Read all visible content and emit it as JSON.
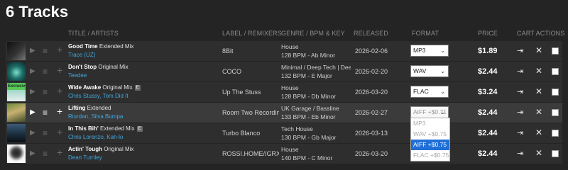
{
  "page": {
    "title": "6 Tracks"
  },
  "headers": {
    "title_artists": "TITLE / ARTISTS",
    "label_remixers": "LABEL / REMIXERS",
    "genre": "GENRE / BPM & KEY",
    "released": "RELEASED",
    "format": "FORMAT",
    "price": "PRICE",
    "cart_actions": "CART ACTIONS"
  },
  "tracks": [
    {
      "name": "Good Time",
      "mix": "Extended Mix",
      "explicit": false,
      "artists": "Trace (UZ)",
      "label": "8Bit",
      "genre": "House",
      "bpm_key": "128 BPM - Ab Minor",
      "released": "2026-02-06",
      "format": "MP3",
      "price": "$1.89",
      "exclusive": false
    },
    {
      "name": "Don't Stop",
      "mix": "Original Mix",
      "explicit": false,
      "artists": "Teedee",
      "label": "COCO",
      "genre": "Minimal / Deep Tech | Dee",
      "bpm_key": "132 BPM - E Major",
      "released": "2026-02-20",
      "format": "WAV",
      "price": "$2.44",
      "exclusive": false
    },
    {
      "name": "Wide Awake",
      "mix": "Original Mix",
      "explicit": true,
      "artists": "Chris Stussy, Tom Did It",
      "label": "Up The Stuss",
      "genre": "House",
      "bpm_key": "128 BPM - Db Minor",
      "released": "2026-03-20",
      "format": "FLAC",
      "price": "$3.24",
      "exclusive": true
    },
    {
      "name": "Lifting",
      "mix": "Extended",
      "explicit": false,
      "artists": "Riordan, Silva Bumpa",
      "label": "Room Two Recordin",
      "genre": "UK Garage / Bassline",
      "bpm_key": "133 BPM - Eb Minor",
      "released": "2026-02-27",
      "format": "AIFF +$0.71",
      "price": "$2.44",
      "exclusive": false
    },
    {
      "name": "In This Bih'",
      "mix": "Extended Mix",
      "explicit": true,
      "artists": "Chris Lorenzo, Kah-lo",
      "label": "Turbo Blanco",
      "genre": "Tech House",
      "bpm_key": "130 BPM - Gb Major",
      "released": "2026-03-13",
      "format": "",
      "price": "$2.44",
      "exclusive": false
    },
    {
      "name": "Actin' Tough",
      "mix": "Original Mix",
      "explicit": false,
      "artists": "Dean Turnley",
      "label": "ROSSI.HOME//GRXV",
      "genre": "House",
      "bpm_key": "140 BPM - C Minor",
      "released": "2026-03-20",
      "format": "",
      "price": "$2.44",
      "exclusive": false
    }
  ],
  "exclusive_badge": "Exclusive",
  "explicit_badge": "E",
  "format_dropdown": {
    "options": [
      "MP3",
      "WAV +$0.75",
      "AIFF +$0.75",
      "FLAC +$0.75"
    ],
    "selected": "AIFF +$0.75"
  },
  "icons": {
    "play": "▶",
    "queue": "≡",
    "add": "+",
    "cart": "⇥",
    "remove": "✕",
    "select_arrow": "⌄"
  },
  "colors": {
    "background": "#242424",
    "row": "#2e2e2e",
    "row_highlight": "#3b3b3b",
    "artist_link": "#3fa8e0",
    "dropdown_selected": "#1f6fd6",
    "exclusive_badge": "#5ac85a"
  }
}
